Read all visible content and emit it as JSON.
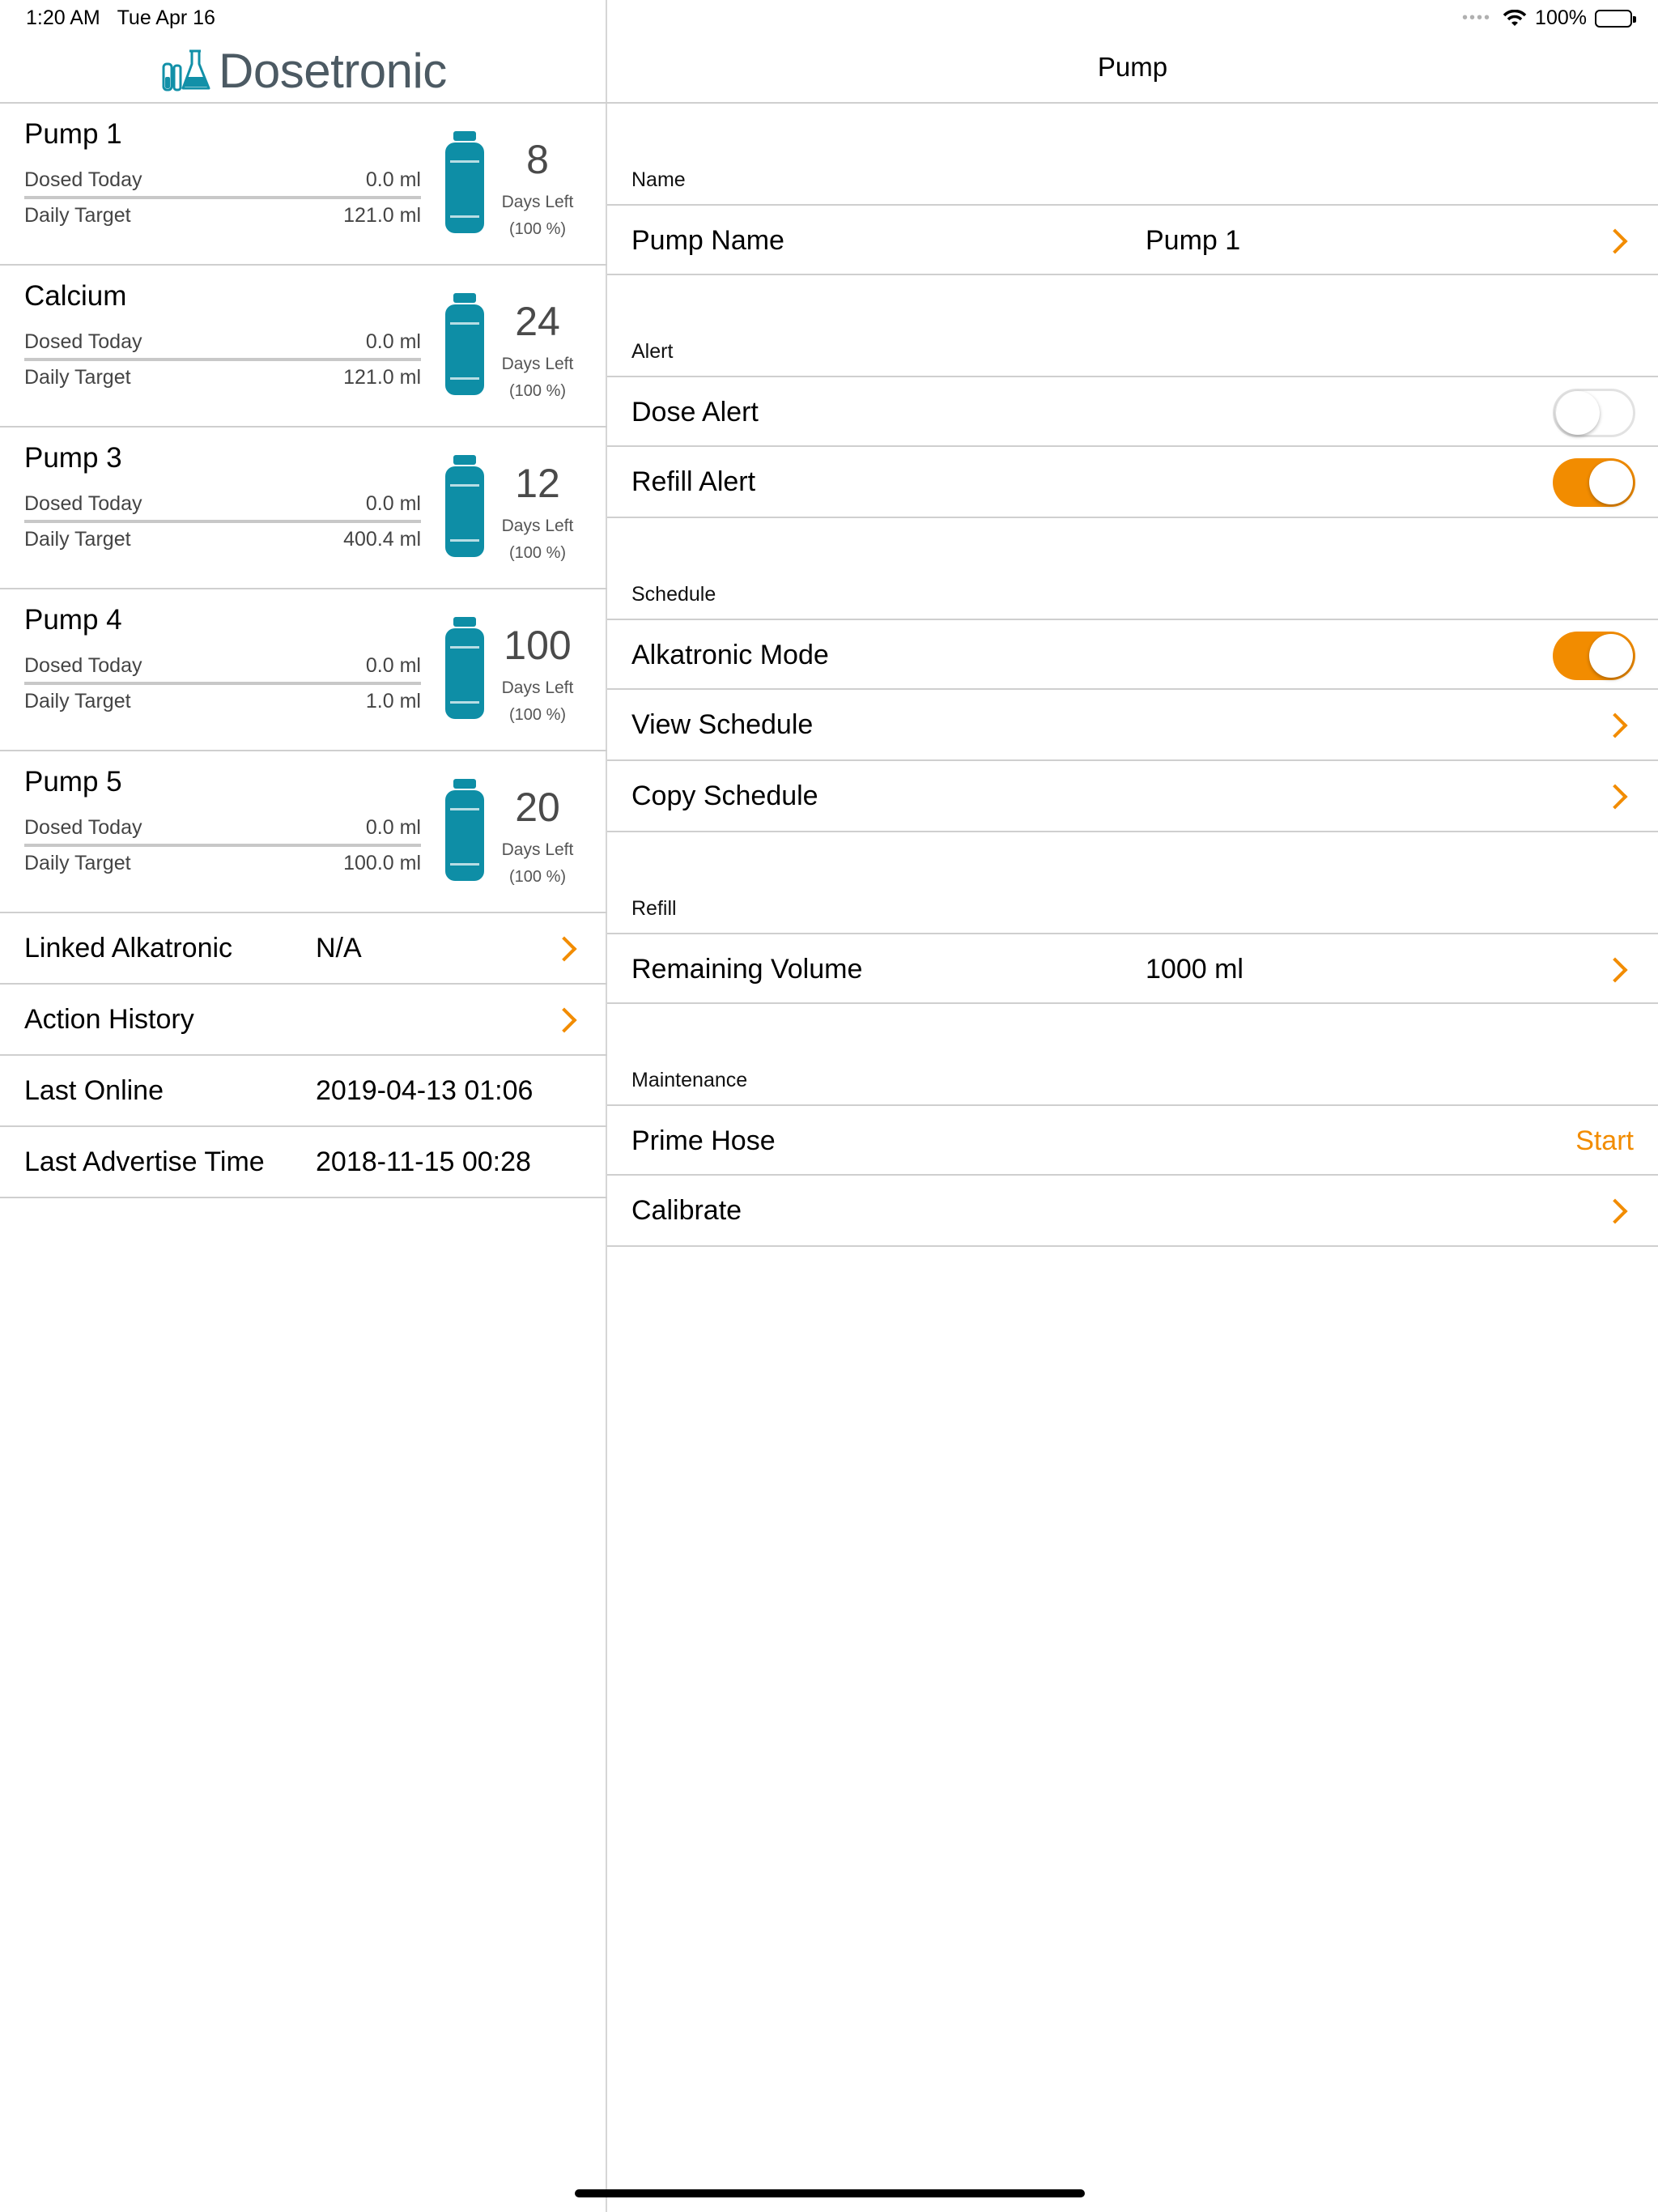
{
  "status_bar": {
    "time": "1:20 AM",
    "date": "Tue Apr 16",
    "battery": "100%"
  },
  "brand": {
    "name": "Dosetronic",
    "logo_color": "#1290a8",
    "text_color": "#4c5a63"
  },
  "pumps": [
    {
      "name": "Pump 1",
      "dosed_label": "Dosed Today",
      "dosed_value": "0.0 ml",
      "target_label": "Daily Target",
      "target_value": "121.0 ml",
      "days": "8",
      "days_label": "Days Left",
      "percent": "(100 %)"
    },
    {
      "name": "Calcium",
      "dosed_label": "Dosed Today",
      "dosed_value": "0.0 ml",
      "target_label": "Daily Target",
      "target_value": "121.0 ml",
      "days": "24",
      "days_label": "Days Left",
      "percent": "(100 %)"
    },
    {
      "name": "Pump 3",
      "dosed_label": "Dosed Today",
      "dosed_value": "0.0 ml",
      "target_label": "Daily Target",
      "target_value": "400.4 ml",
      "days": "12",
      "days_label": "Days Left",
      "percent": "(100 %)"
    },
    {
      "name": "Pump 4",
      "dosed_label": "Dosed Today",
      "dosed_value": "0.0 ml",
      "target_label": "Daily Target",
      "target_value": "1.0 ml",
      "days": "100",
      "days_label": "Days Left",
      "percent": "(100 %)"
    },
    {
      "name": "Pump 5",
      "dosed_label": "Dosed Today",
      "dosed_value": "0.0 ml",
      "target_label": "Daily Target",
      "target_value": "100.0 ml",
      "days": "20",
      "days_label": "Days Left",
      "percent": "(100 %)"
    }
  ],
  "device_info": [
    {
      "title": "Linked Alkatronic",
      "value": "N/A"
    },
    {
      "title": "Action History",
      "value": ""
    },
    {
      "title": "Last Online",
      "value": "2019-04-13 01:06"
    },
    {
      "title": "Last Advertise Time",
      "value": "2018-11-15 00:28"
    }
  ],
  "detail": {
    "title": "Pump",
    "name_section": {
      "header": "Name",
      "pump_name_label": "Pump Name",
      "pump_name_value": "Pump 1"
    },
    "alert_section": {
      "header": "Alert",
      "dose_alert_label": "Dose Alert",
      "dose_alert_on": false,
      "refill_alert_label": "Refill Alert",
      "refill_alert_on": true
    },
    "schedule_section": {
      "header": "Schedule",
      "alkatronic_mode_label": "Alkatronic Mode",
      "alkatronic_mode_on": true,
      "view_schedule_label": "View Schedule",
      "copy_schedule_label": "Copy Schedule"
    },
    "refill_section": {
      "header": "Refill",
      "remaining_label": "Remaining Volume",
      "remaining_value": "1000 ml"
    },
    "maintenance_section": {
      "header": "Maintenance",
      "prime_hose_label": "Prime Hose",
      "prime_hose_action": "Start",
      "calibrate_label": "Calibrate"
    }
  },
  "colors": {
    "accent": "#f28c00",
    "bottle": "#0e8ea6",
    "separator": "#cfcfcf"
  }
}
